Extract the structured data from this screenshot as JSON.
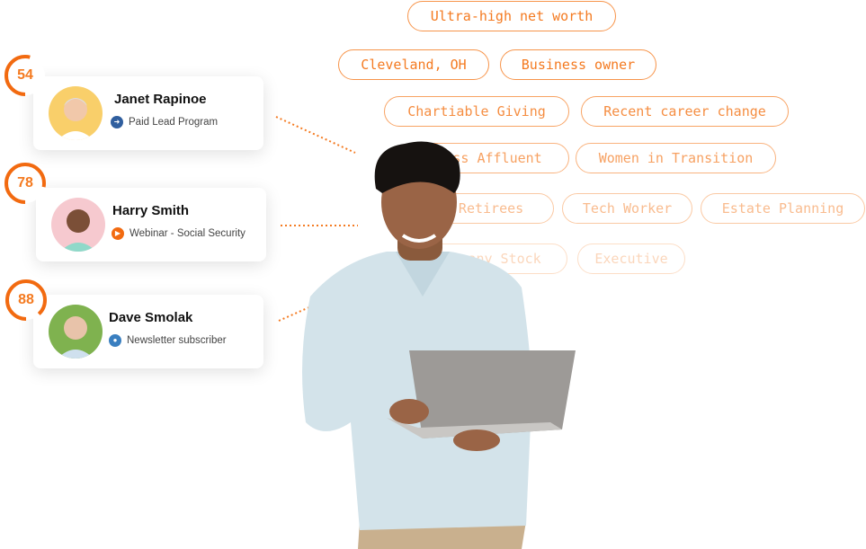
{
  "tags": [
    {
      "label": "Ultra-high net worth",
      "row": 1
    },
    {
      "label": "Cleveland, OH",
      "row": 2
    },
    {
      "label": "Business owner",
      "row": 2
    },
    {
      "label": "Chartiable Giving",
      "row": 3
    },
    {
      "label": "Recent career change",
      "row": 3
    },
    {
      "label": "Mass Affluent",
      "row": 4
    },
    {
      "label": "Women in Transition",
      "row": 4
    },
    {
      "label": "Pre-Retirees",
      "row": 5
    },
    {
      "label": "Tech Worker",
      "row": 5
    },
    {
      "label": "Estate Planning",
      "row": 5
    },
    {
      "label": "Company Stock",
      "row": 6
    },
    {
      "label": "Executive",
      "row": 6
    }
  ],
  "leads": [
    {
      "score": "54",
      "score_value": 54,
      "name": "Janet Rapinoe",
      "source": "Paid Lead Program",
      "source_icon": "sign-in-icon",
      "icon_color": "#2f5e9e",
      "avatar_bg": "#f9cf6a"
    },
    {
      "score": "78",
      "score_value": 78,
      "name": "Harry Smith",
      "source": "Webinar - Social Security",
      "source_icon": "play-icon",
      "icon_color": "#f26a10",
      "avatar_bg": "#f6c9cf"
    },
    {
      "score": "88",
      "score_value": 88,
      "name": "Dave Smolak",
      "source": "Newsletter subscriber",
      "source_icon": "microphone-icon",
      "icon_color": "#3a7fc0",
      "avatar_bg": "#7fb24f"
    }
  ],
  "colors": {
    "accent": "#f47a20",
    "tag_border": "#f7944a"
  }
}
